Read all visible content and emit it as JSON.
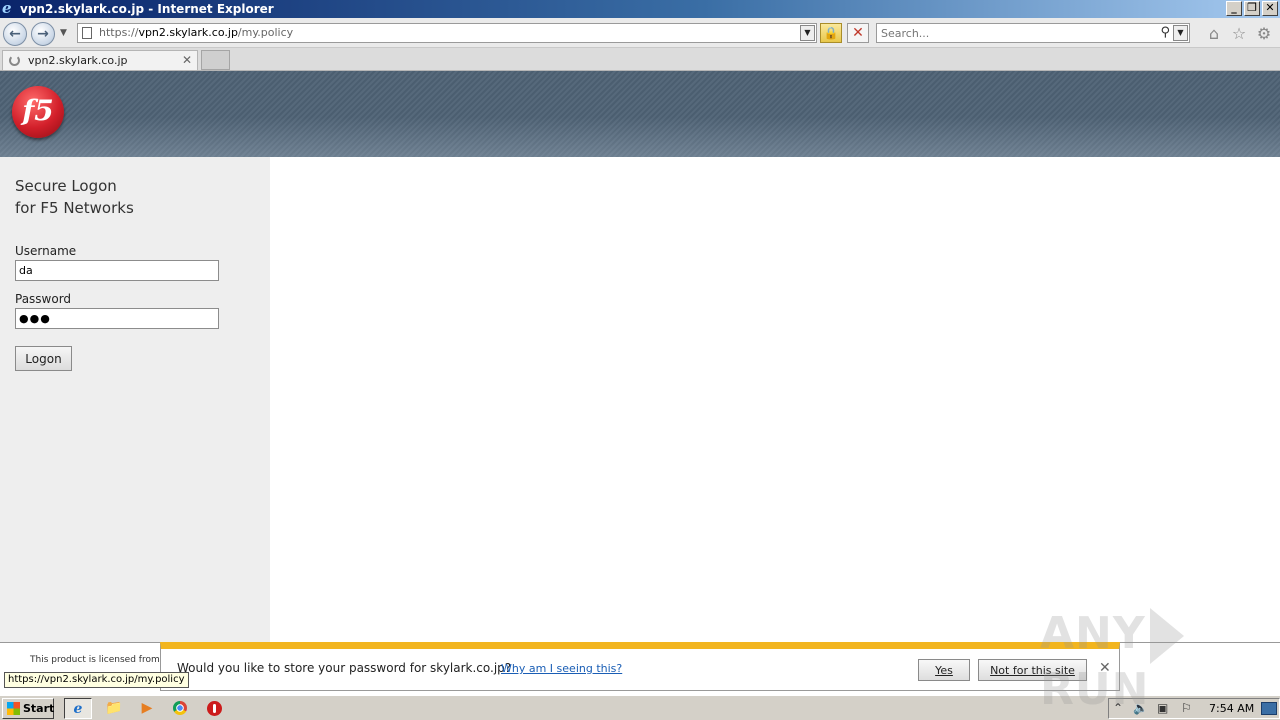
{
  "window": {
    "title": "vpn2.skylark.co.jp - Internet Explorer"
  },
  "toolbar": {
    "url_scheme": "https://",
    "url_host": "vpn2.skylark.co.jp",
    "url_path": "/my.policy",
    "search_placeholder": "Search..."
  },
  "tabs": [
    {
      "label": "vpn2.skylark.co.jp"
    }
  ],
  "page": {
    "logo_text": "f5",
    "title_line1": "Secure Logon",
    "title_line2": "for F5 Networks",
    "username_label": "Username",
    "username_value": "da",
    "password_label": "Password",
    "password_value": "●●●",
    "logon_button": "Logon",
    "license_text": "This product is licensed from"
  },
  "status_bar": {
    "url": "https://vpn2.skylark.co.jp/my.policy"
  },
  "notification": {
    "message": "Would you like to store your password for skylark.co.jp?",
    "link": "Why am I seeing this?",
    "yes_label": "Yes",
    "not_for_site_label": "Not for this site"
  },
  "watermark": {
    "left": "ANY",
    "right": "RUN"
  },
  "taskbar": {
    "start_label": "Start",
    "clock": "7:54 AM"
  },
  "colors": {
    "notification_accent": "#f2b51f",
    "banner": "#4b5e70",
    "f5_red": "#d21f2a"
  }
}
